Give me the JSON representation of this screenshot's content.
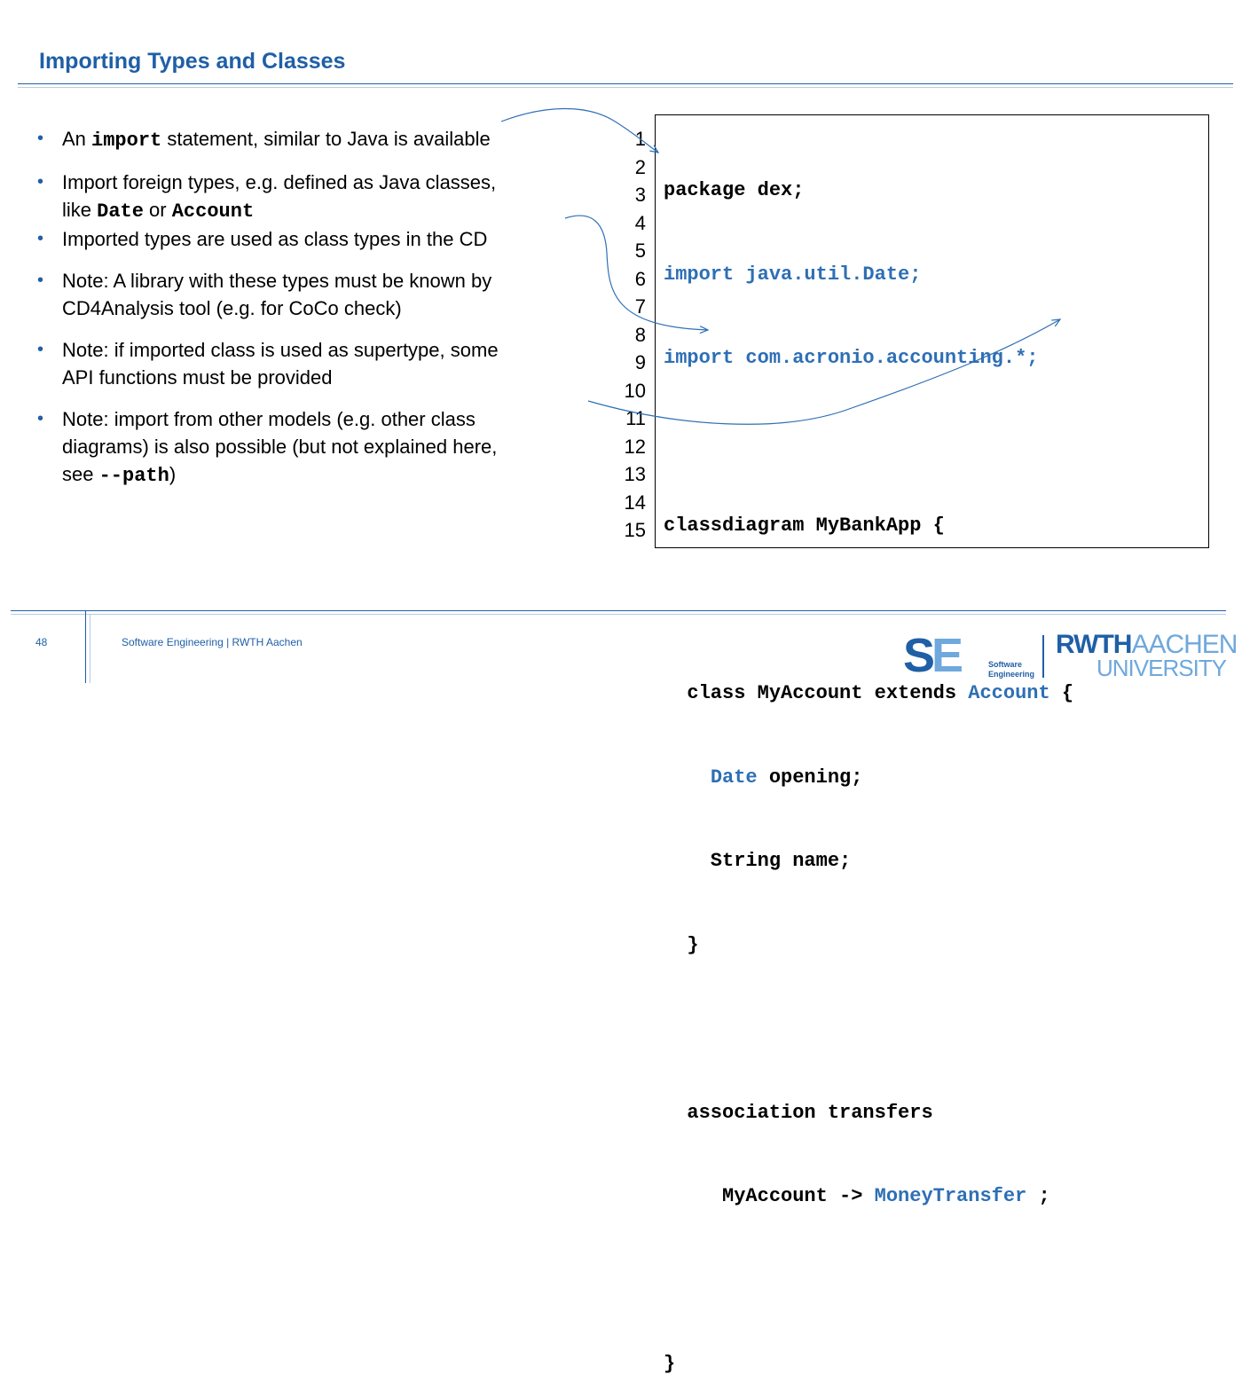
{
  "slide": {
    "title": "Importing Types and Classes",
    "page_number": "48",
    "footer": "Software Engineering  |  RWTH Aachen"
  },
  "bullets": [
    {
      "pre": "An ",
      "code": "import",
      "post": " statement, similar to Java is available"
    },
    {
      "l1": "Import foreign types, e.g. defined as Java classes,",
      "l2_pre": "like ",
      "code1": "Date",
      "mid": " or ",
      "code2": "Account"
    },
    {
      "text": "Imported types are used as class types in the CD"
    },
    {
      "l1": "Note: A library with these types must be known by",
      "l2": "CD4Analysis tool (e.g. for CoCo check)"
    },
    {
      "l1": "Note: if imported class is used as supertype, some",
      "l2": "API functions must be provided"
    },
    {
      "l1": "Note: import from other models (e.g. other class",
      "l2": "diagrams) is also possible (but not explained here,",
      "l3_pre": "see ",
      "code": "--path",
      "l3_post": ")"
    }
  ],
  "code": {
    "line_numbers": [
      "1",
      "2",
      "3",
      "4",
      "5",
      "6",
      "7",
      "8",
      "9",
      "10",
      "11",
      "12",
      "13",
      "14",
      "15"
    ],
    "l1": "package dex;",
    "l2": "import java.util.Date;",
    "l3": "import com.acronio.accounting.*;",
    "l5": "classdiagram MyBankApp {",
    "l7_a": "  class MyAccount extends ",
    "l7_b": "Account",
    "l7_c": " {",
    "l8_a": "    ",
    "l8_b": "Date",
    "l8_c": " opening;",
    "l9": "    String name;",
    "l10": "  }",
    "l12": "  association transfers",
    "l13_a": "     MyAccount -> ",
    "l13_b": "MoneyTransfer",
    "l13_c": " ;",
    "l15": "}"
  },
  "logos": {
    "se_s": "S",
    "se_e": "E",
    "se_line1": "Software",
    "se_line2": "Engineering",
    "rwth": "RWTH",
    "aachen": "AACHEN",
    "university": "UNIVERSITY"
  },
  "colors": {
    "accent": "#1f5fa6",
    "light_accent": "#6fa8dc",
    "code_blue": "#2e6fb5"
  }
}
